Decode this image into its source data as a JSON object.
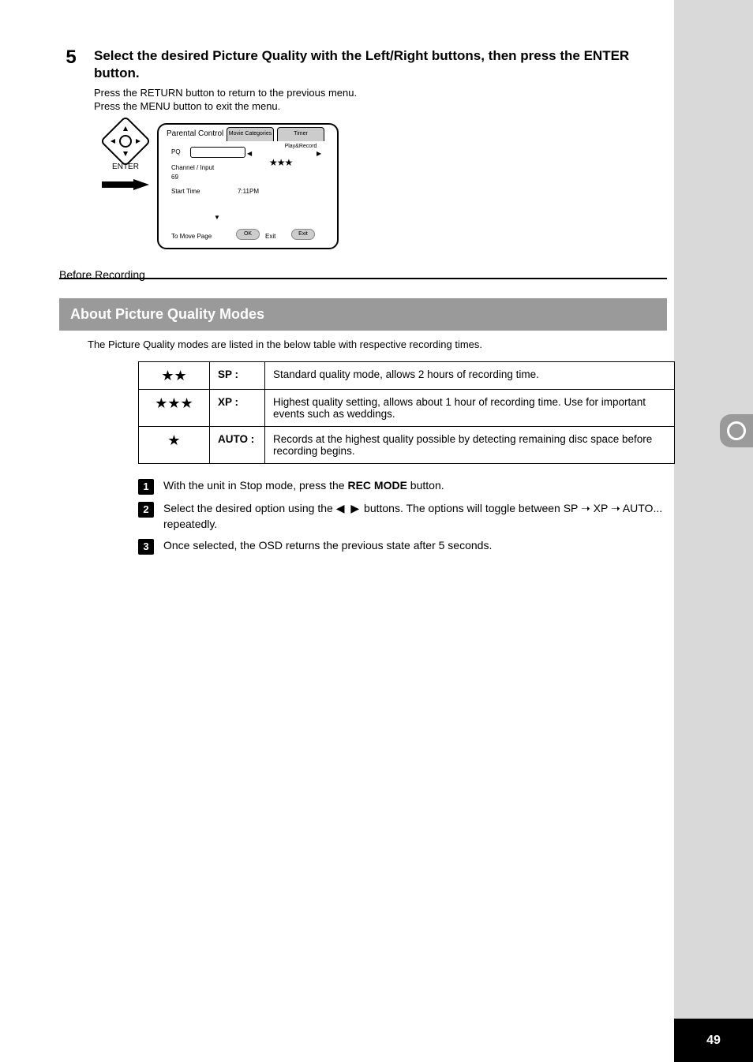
{
  "page_number": "49",
  "step5": {
    "number": "5",
    "title": "Select the desired Picture Quality with the Left/Right buttons, then press the ENTER button.",
    "desc_line1": "Press the RETURN button to return to the previous menu.",
    "desc_line2": "Press the MENU button to exit the menu."
  },
  "remote": {
    "enter": "ENTER"
  },
  "screen": {
    "title": "Parental Control",
    "tab1": "Movie Categories",
    "tab2": "Timer Play&Record",
    "row1_label": "PQ",
    "tri_stars": "★★★",
    "row2": "Channel / Input",
    "row2b": "69",
    "row3": "Start Time",
    "time": "7:11PM",
    "footer_left": "To Move Page",
    "btn1": "OK",
    "footer_right": "Exit",
    "btn2": "Exit"
  },
  "divider_label": "Before Recording",
  "section": {
    "heading": "About Picture Quality Modes",
    "sub": "The Picture Quality modes are listed in the below table with respective recording times."
  },
  "modes_table": [
    {
      "stars": "★★",
      "label": "SP :",
      "desc": "Standard quality mode, allows 2 hours of recording time."
    },
    {
      "stars": "★★★",
      "label": "XP :",
      "desc": "Highest quality setting, allows about 1 hour of recording time. Use for important events such as weddings."
    },
    {
      "stars": "★",
      "label": "AUTO :",
      "desc": "Records at the highest quality possible by detecting remaining disc space before recording begins."
    }
  ],
  "steps_list": [
    {
      "n": "1",
      "text_a": "With the unit in Stop mode, press the ",
      "bold": "REC MODE",
      "text_b": " button."
    },
    {
      "n": "2",
      "text_a": "Select the desired option using the ",
      "arrows": "◀ ▶",
      "text_b": " buttons. The options will toggle between SP ➝ XP ➝ AUTO... repeatedly."
    },
    {
      "n": "3",
      "text_a": "Once selected, the OSD returns the previous state after 5 seconds.",
      "bold": "",
      "text_b": ""
    }
  ]
}
